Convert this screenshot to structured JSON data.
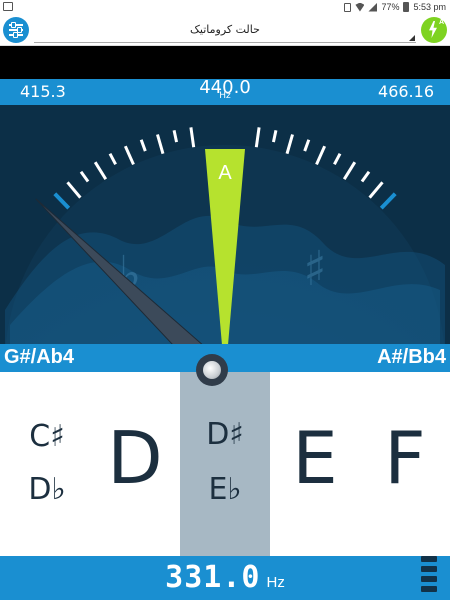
{
  "status_bar": {
    "battery_percent": "77%",
    "time": "5:53 pm",
    "icons": [
      "image-icon",
      "vibrate-icon",
      "wifi-icon",
      "signal-icon",
      "battery-icon"
    ]
  },
  "app_bar": {
    "mode_label": "حالت کروماتیک",
    "auto_label": "A",
    "settings_icon": "settings-sliders-icon",
    "auto_icon": "auto-lightning-icon"
  },
  "freq_bar": {
    "low_freq": "415.3",
    "center_freq": "440.0",
    "center_unit": "Hz",
    "high_freq": "466.16"
  },
  "meter": {
    "target_note": "A",
    "flat_symbol": "♭",
    "sharp_symbol": "♯",
    "needle_deviation": -1.0,
    "colors": {
      "background": "#0c2f47",
      "target_wedge": "#b6e22e",
      "edge_ticks": "#1a8fd1",
      "ticks": "#ffffff"
    }
  },
  "note_bar": {
    "left_note": "G#/Ab4",
    "right_note": "A#/Bb4"
  },
  "notes": {
    "col1_top": "C♯",
    "col1_bottom": "D♭",
    "col2": "D",
    "col3_top": "D♯",
    "col3_bottom": "E♭",
    "col4": "E",
    "col5": "F"
  },
  "readout": {
    "frequency": "331.0",
    "unit": "Hz"
  },
  "colors": {
    "accent": "#1a8fd1",
    "auto_green": "#7ed321",
    "highlight": "#a7b8c4",
    "note_text": "#1c2f3f"
  }
}
